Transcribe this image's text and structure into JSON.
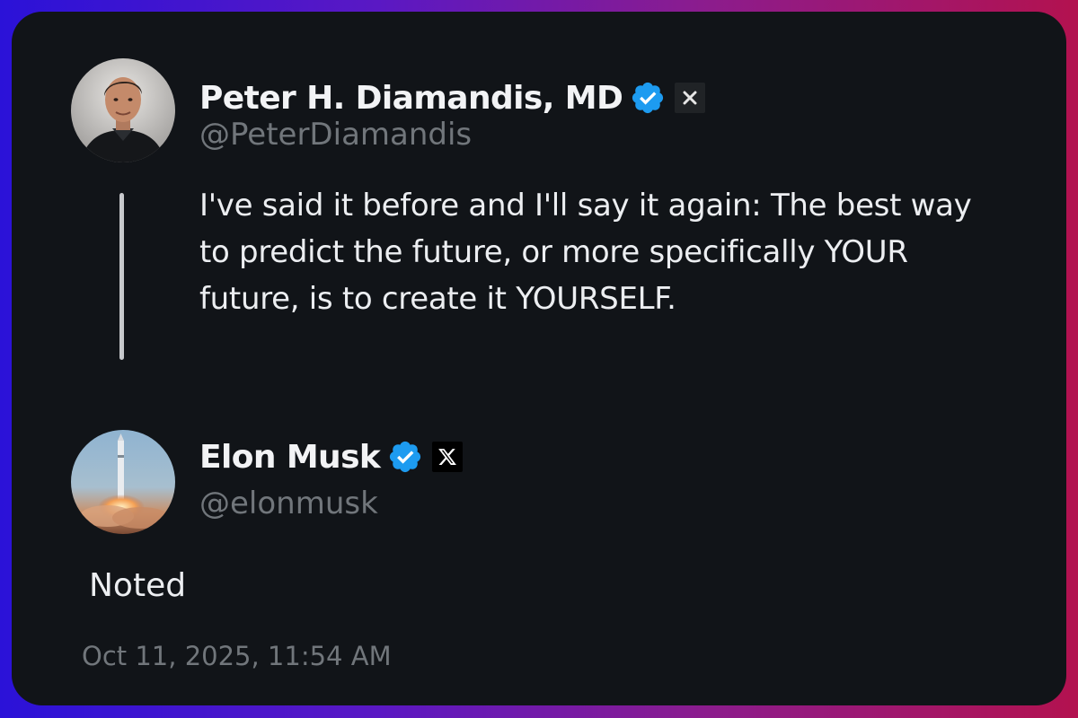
{
  "original_tweet": {
    "author": {
      "display_name": "Peter H. Diamandis, MD",
      "handle": "@PeterDiamandis",
      "verified": true,
      "avatar_icon": "profile-photo-icon",
      "badge_icon": "x-close-icon"
    },
    "text": "I've said it before and I'll say it again: The best way to predict the future, or more specifically YOUR future, is to create it YOURSELF."
  },
  "reply_tweet": {
    "author": {
      "display_name": "Elon Musk",
      "handle": "@elonmusk",
      "verified": true,
      "avatar_icon": "rocket-launch-icon",
      "badge_icon": "x-logo-icon"
    },
    "text": "Noted",
    "timestamp": "Oct 11, 2025, 11:54 AM"
  },
  "colors": {
    "card_background": "#111418",
    "verified_blue": "#1d9bf0",
    "secondary_text": "#71767b",
    "primary_text": "#eceef1"
  }
}
